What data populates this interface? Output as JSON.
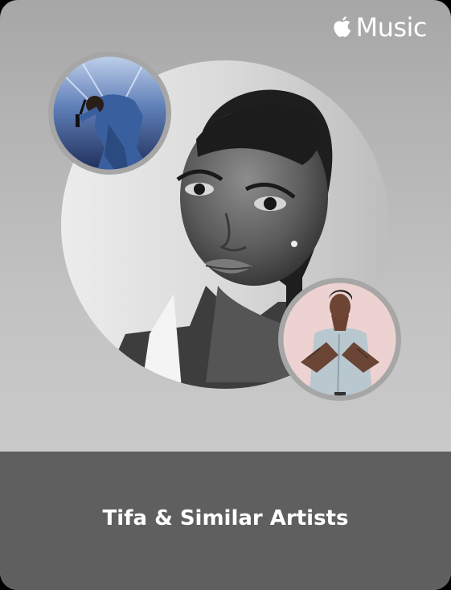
{
  "brand": {
    "icon": "apple-logo-icon",
    "name": "Music"
  },
  "artworks": {
    "main": "main-artist-photo",
    "top_left": "similar-artist-photo-1",
    "bottom_right": "similar-artist-photo-2"
  },
  "footer": {
    "title": "Tifa & Similar Artists"
  },
  "colors": {
    "card_background": "#bdbdbd",
    "footer_background": "#5f5f5f",
    "text": "#ffffff"
  }
}
